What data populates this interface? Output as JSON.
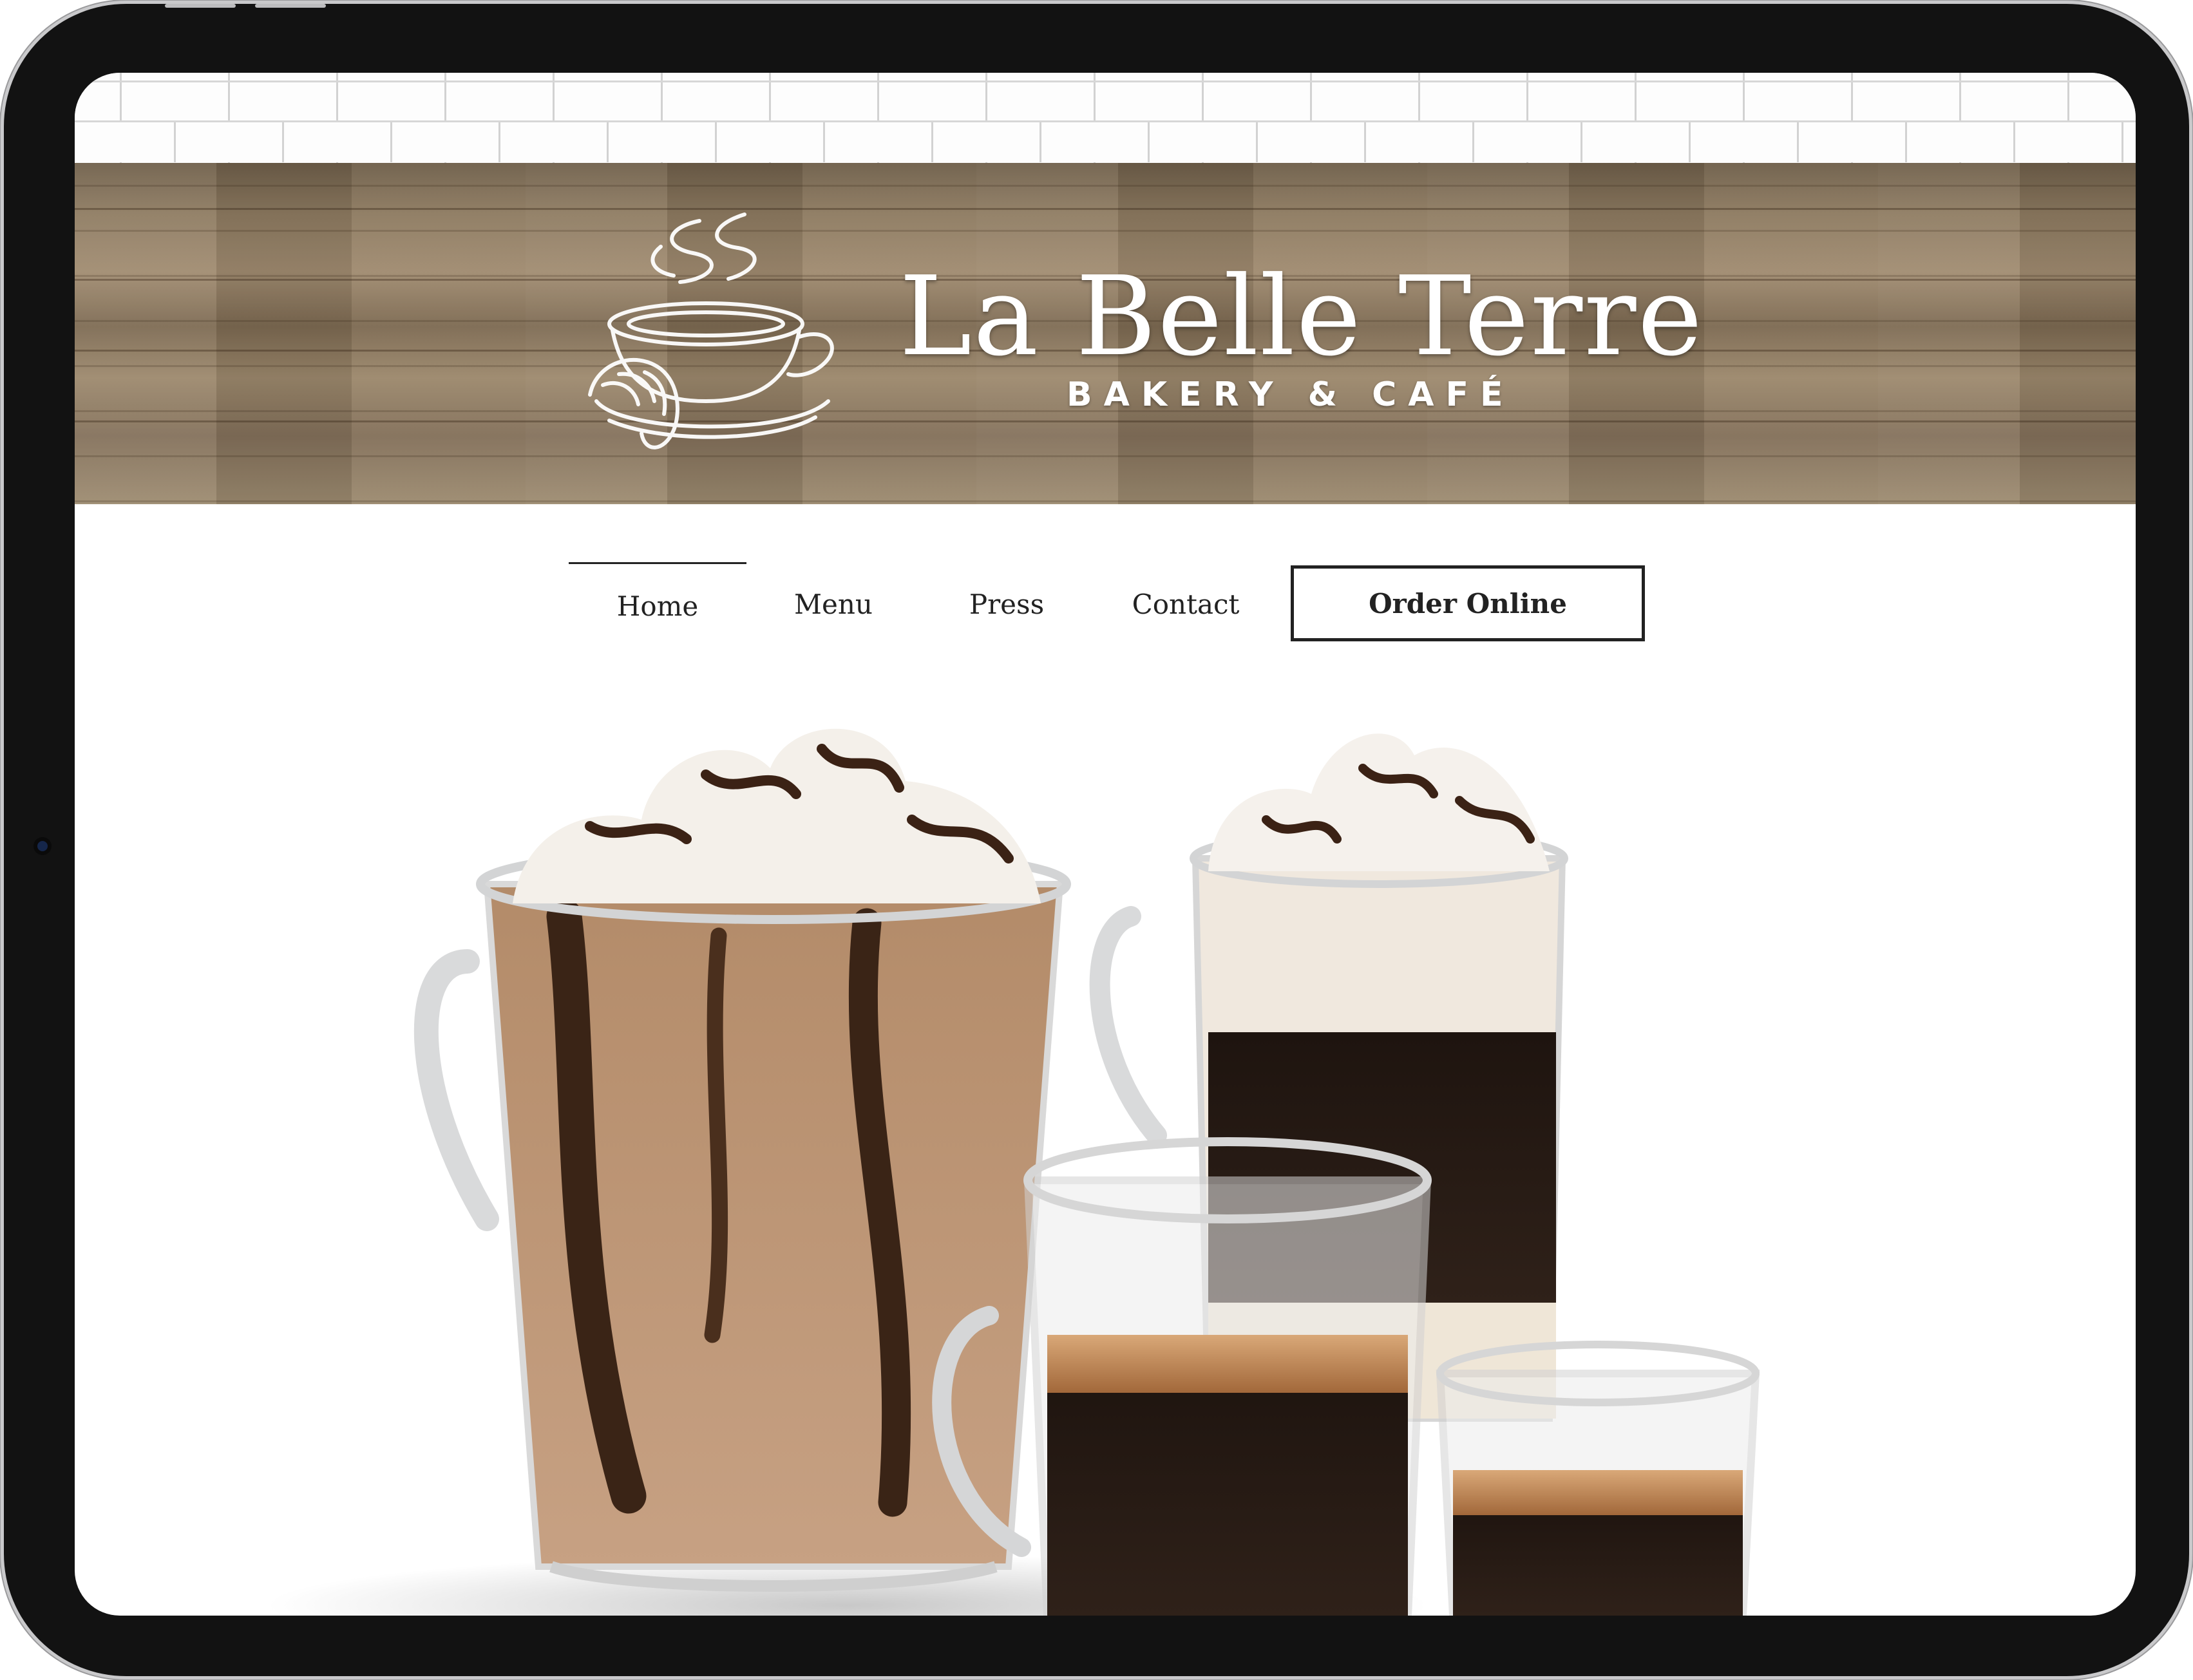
{
  "brand": {
    "title": "La Belle Terre",
    "subtitle": "BAKERY & CAFÉ",
    "logo_icon": "coffee-cup-croissant-icon"
  },
  "nav": {
    "items": [
      {
        "label": "Home",
        "active": true
      },
      {
        "label": "Menu",
        "active": false
      },
      {
        "label": "Press",
        "active": false
      },
      {
        "label": "Contact",
        "active": false
      }
    ],
    "order_button": "Order Online"
  },
  "hero": {
    "description_icon": "coffee-drinks-photo"
  },
  "colors": {
    "text": "#222222",
    "wood": "#8e7b61",
    "frame": "#121212"
  }
}
